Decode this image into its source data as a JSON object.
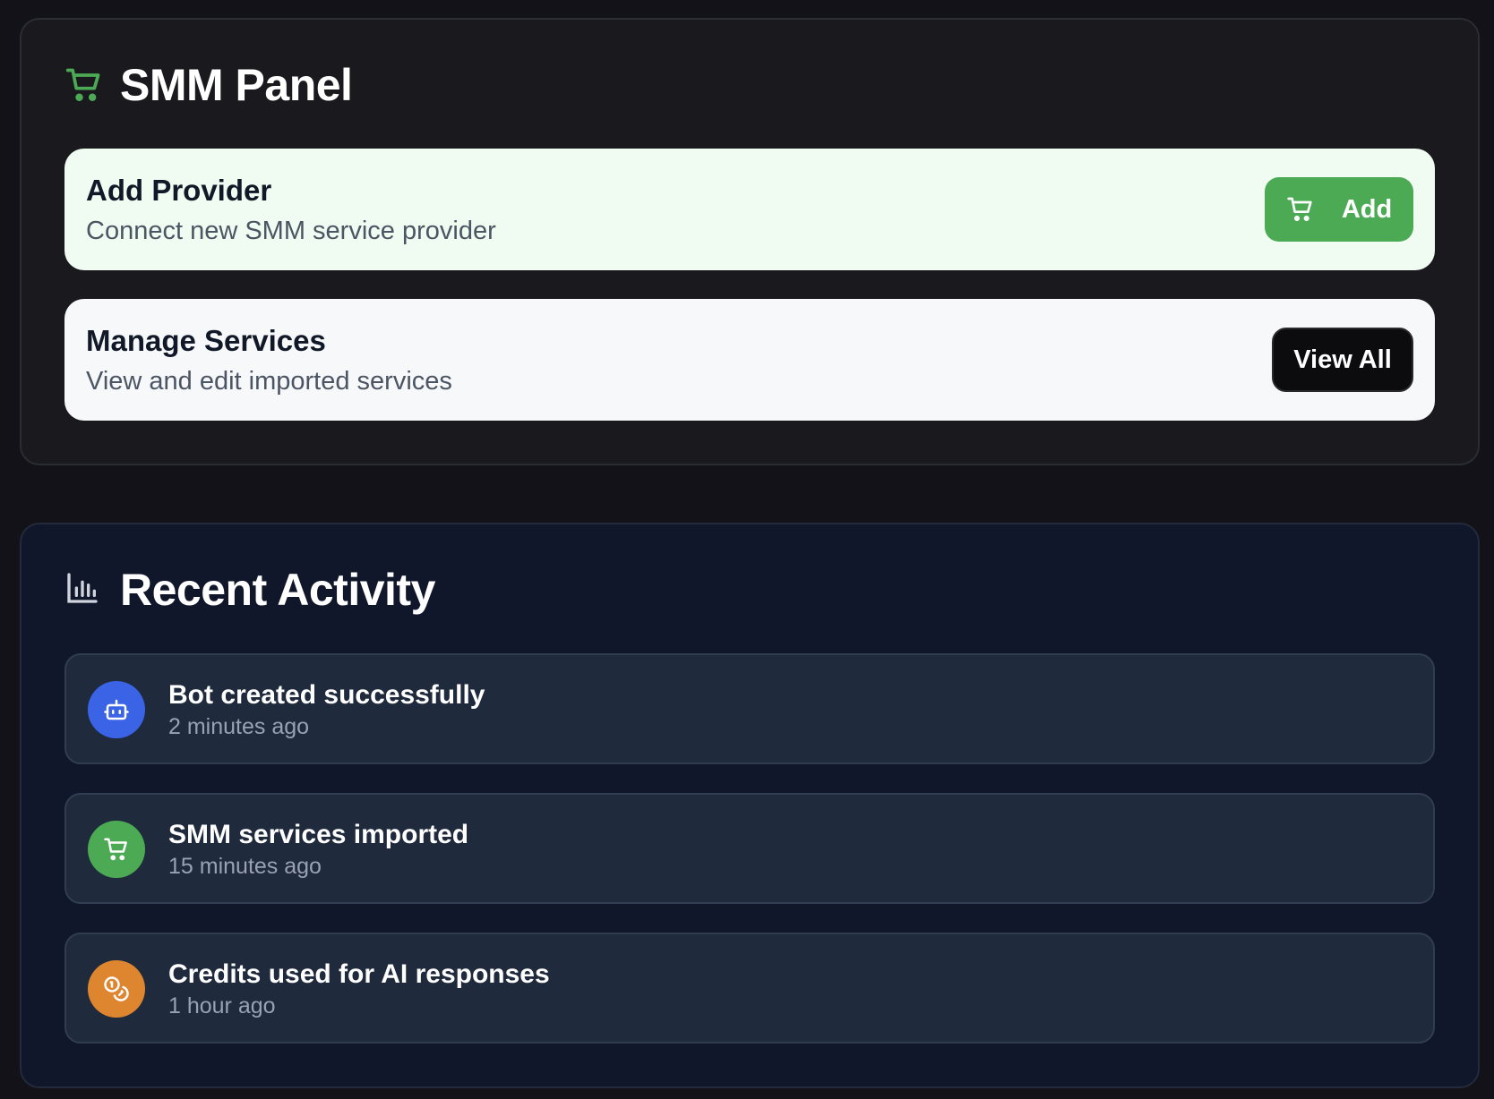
{
  "smm_panel": {
    "title": "SMM Panel",
    "title_icon": "cart-icon",
    "accent_color": "#4caa55",
    "add_provider": {
      "title": "Add Provider",
      "subtitle": "Connect new SMM service provider",
      "button_label": "Add",
      "button_icon": "cart-icon"
    },
    "manage_services": {
      "title": "Manage Services",
      "subtitle": "View and edit imported services",
      "button_label": "View All"
    }
  },
  "recent_activity": {
    "title": "Recent Activity",
    "title_icon": "bar-chart-icon",
    "items": [
      {
        "title": "Bot created successfully",
        "time": "2 minutes ago",
        "icon": "bot-icon",
        "color": "#3a63e6"
      },
      {
        "title": "SMM services imported",
        "time": "15 minutes ago",
        "icon": "cart-icon",
        "color": "#4caa55"
      },
      {
        "title": "Credits used for AI responses",
        "time": "1 hour ago",
        "icon": "coins-icon",
        "color": "#de8530"
      }
    ]
  }
}
